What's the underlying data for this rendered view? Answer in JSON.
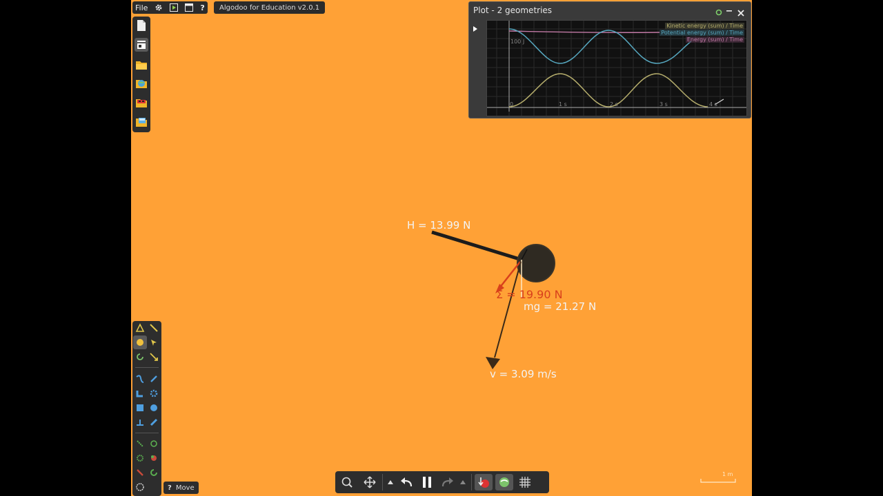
{
  "menu": {
    "file_label": "File",
    "app_title": "Algodoo for Education v2.0.1"
  },
  "plot": {
    "title": "Plot - 2 geometries",
    "legend": [
      "Kinetic energy (sum) / Time",
      "Potential energy (sum) / Time",
      "Energy (sum) / Time"
    ],
    "y_tick": "100 J",
    "x_ticks": [
      "0",
      "1 s",
      "2 s",
      "3 s",
      "4 s"
    ],
    "series_colors": {
      "kinetic": "#b5ad6c",
      "potential": "#56a7bf",
      "total": "#c27aa6"
    }
  },
  "scene": {
    "tension_label": "H = 13.99 N",
    "net_force_label": "Σ = 19.90 N",
    "gravity_label": "mg = 21.27 N",
    "velocity_label": "v = 3.09 m/s",
    "scale_label": "1 m"
  },
  "status": {
    "help": "?",
    "tool_name": "Move"
  },
  "colors": {
    "background": "#ffa136",
    "panel": "#2d2d2d",
    "net_force": "#d8401c",
    "text_light": "#f3f3f3"
  }
}
